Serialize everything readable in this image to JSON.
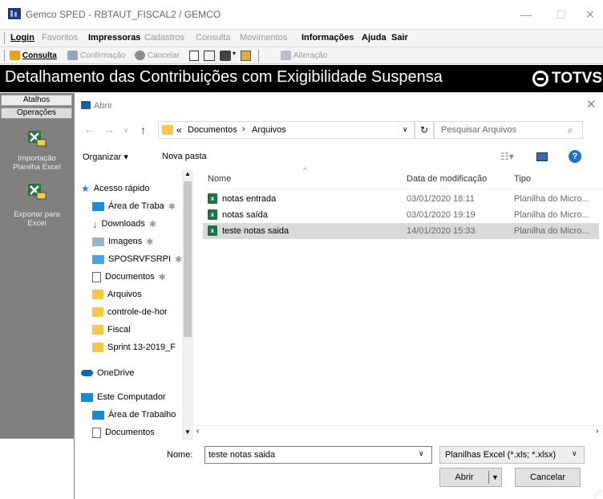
{
  "window": {
    "title": "Gemco SPED - RBTAUT_FISCAL2 / GEMCO",
    "minimize": "—",
    "maximize": "☐",
    "close": "✕"
  },
  "menubar": [
    "Login",
    "Favoritos",
    "Impressoras",
    "Cadastros",
    "Consulta",
    "Movimentos",
    "Informações",
    "Ajuda",
    "Sair"
  ],
  "toolbar": {
    "consulta": "Consulta",
    "confirmacao": "Confirmação",
    "cancelar": "Cancelar",
    "alteracao": "Alteração"
  },
  "banner": {
    "title": "Detalhamento das Contribuições com Exigibilidade Suspensa",
    "logo": "TOTVS"
  },
  "leftpanel": {
    "atalhos": "Atalhos",
    "operacoes": "Operações",
    "import_line1": "Importação",
    "import_line2": "Planilha Excel",
    "export_line1": "Exportar para",
    "export_line2": "Excel"
  },
  "dialog": {
    "title": "Abrir",
    "path_prefix": "«",
    "path_1": "Documentos",
    "path_sep": "›",
    "path_2": "Arquivos",
    "search_placeholder": "Pesquisar Arquivos",
    "organize": "Organizar ▾",
    "new_folder": "Nova pasta",
    "nav": [
      "Acesso rápido",
      "Área de Traba",
      "Downloads",
      "Imagens",
      "SPOSRVFSRPI",
      "Documentos",
      "Arquivos",
      "controle-de-hor",
      "Fiscal",
      "Sprint 13-2019_F",
      "OneDrive",
      "Este Computador",
      "Área de Trabalho",
      "Documentos"
    ],
    "columns": {
      "name": "Nome",
      "date": "Data de modificação",
      "type": "Tipo"
    },
    "files": [
      {
        "name": "notas entrada",
        "date": "03/01/2020 18:11",
        "type": "Planilha do Micro..."
      },
      {
        "name": "notas saída",
        "date": "03/01/2020 19:19",
        "type": "Planilha do Micro..."
      },
      {
        "name": "teste notas saida",
        "date": "14/01/2020 15:33",
        "type": "Planilha do Micro..."
      }
    ],
    "filename_label": "Nome:",
    "filename_value": "teste notas saida",
    "filetype": "Planilhas Excel (*.xls; *.xlsx)",
    "open": "Abrir",
    "cancel": "Cancelar"
  },
  "colors": {
    "banner_bg": "#000000",
    "selection": "#d9d9d9",
    "folder": "#f6c748",
    "excel": "#1e7145",
    "help": "#1f73c6"
  }
}
